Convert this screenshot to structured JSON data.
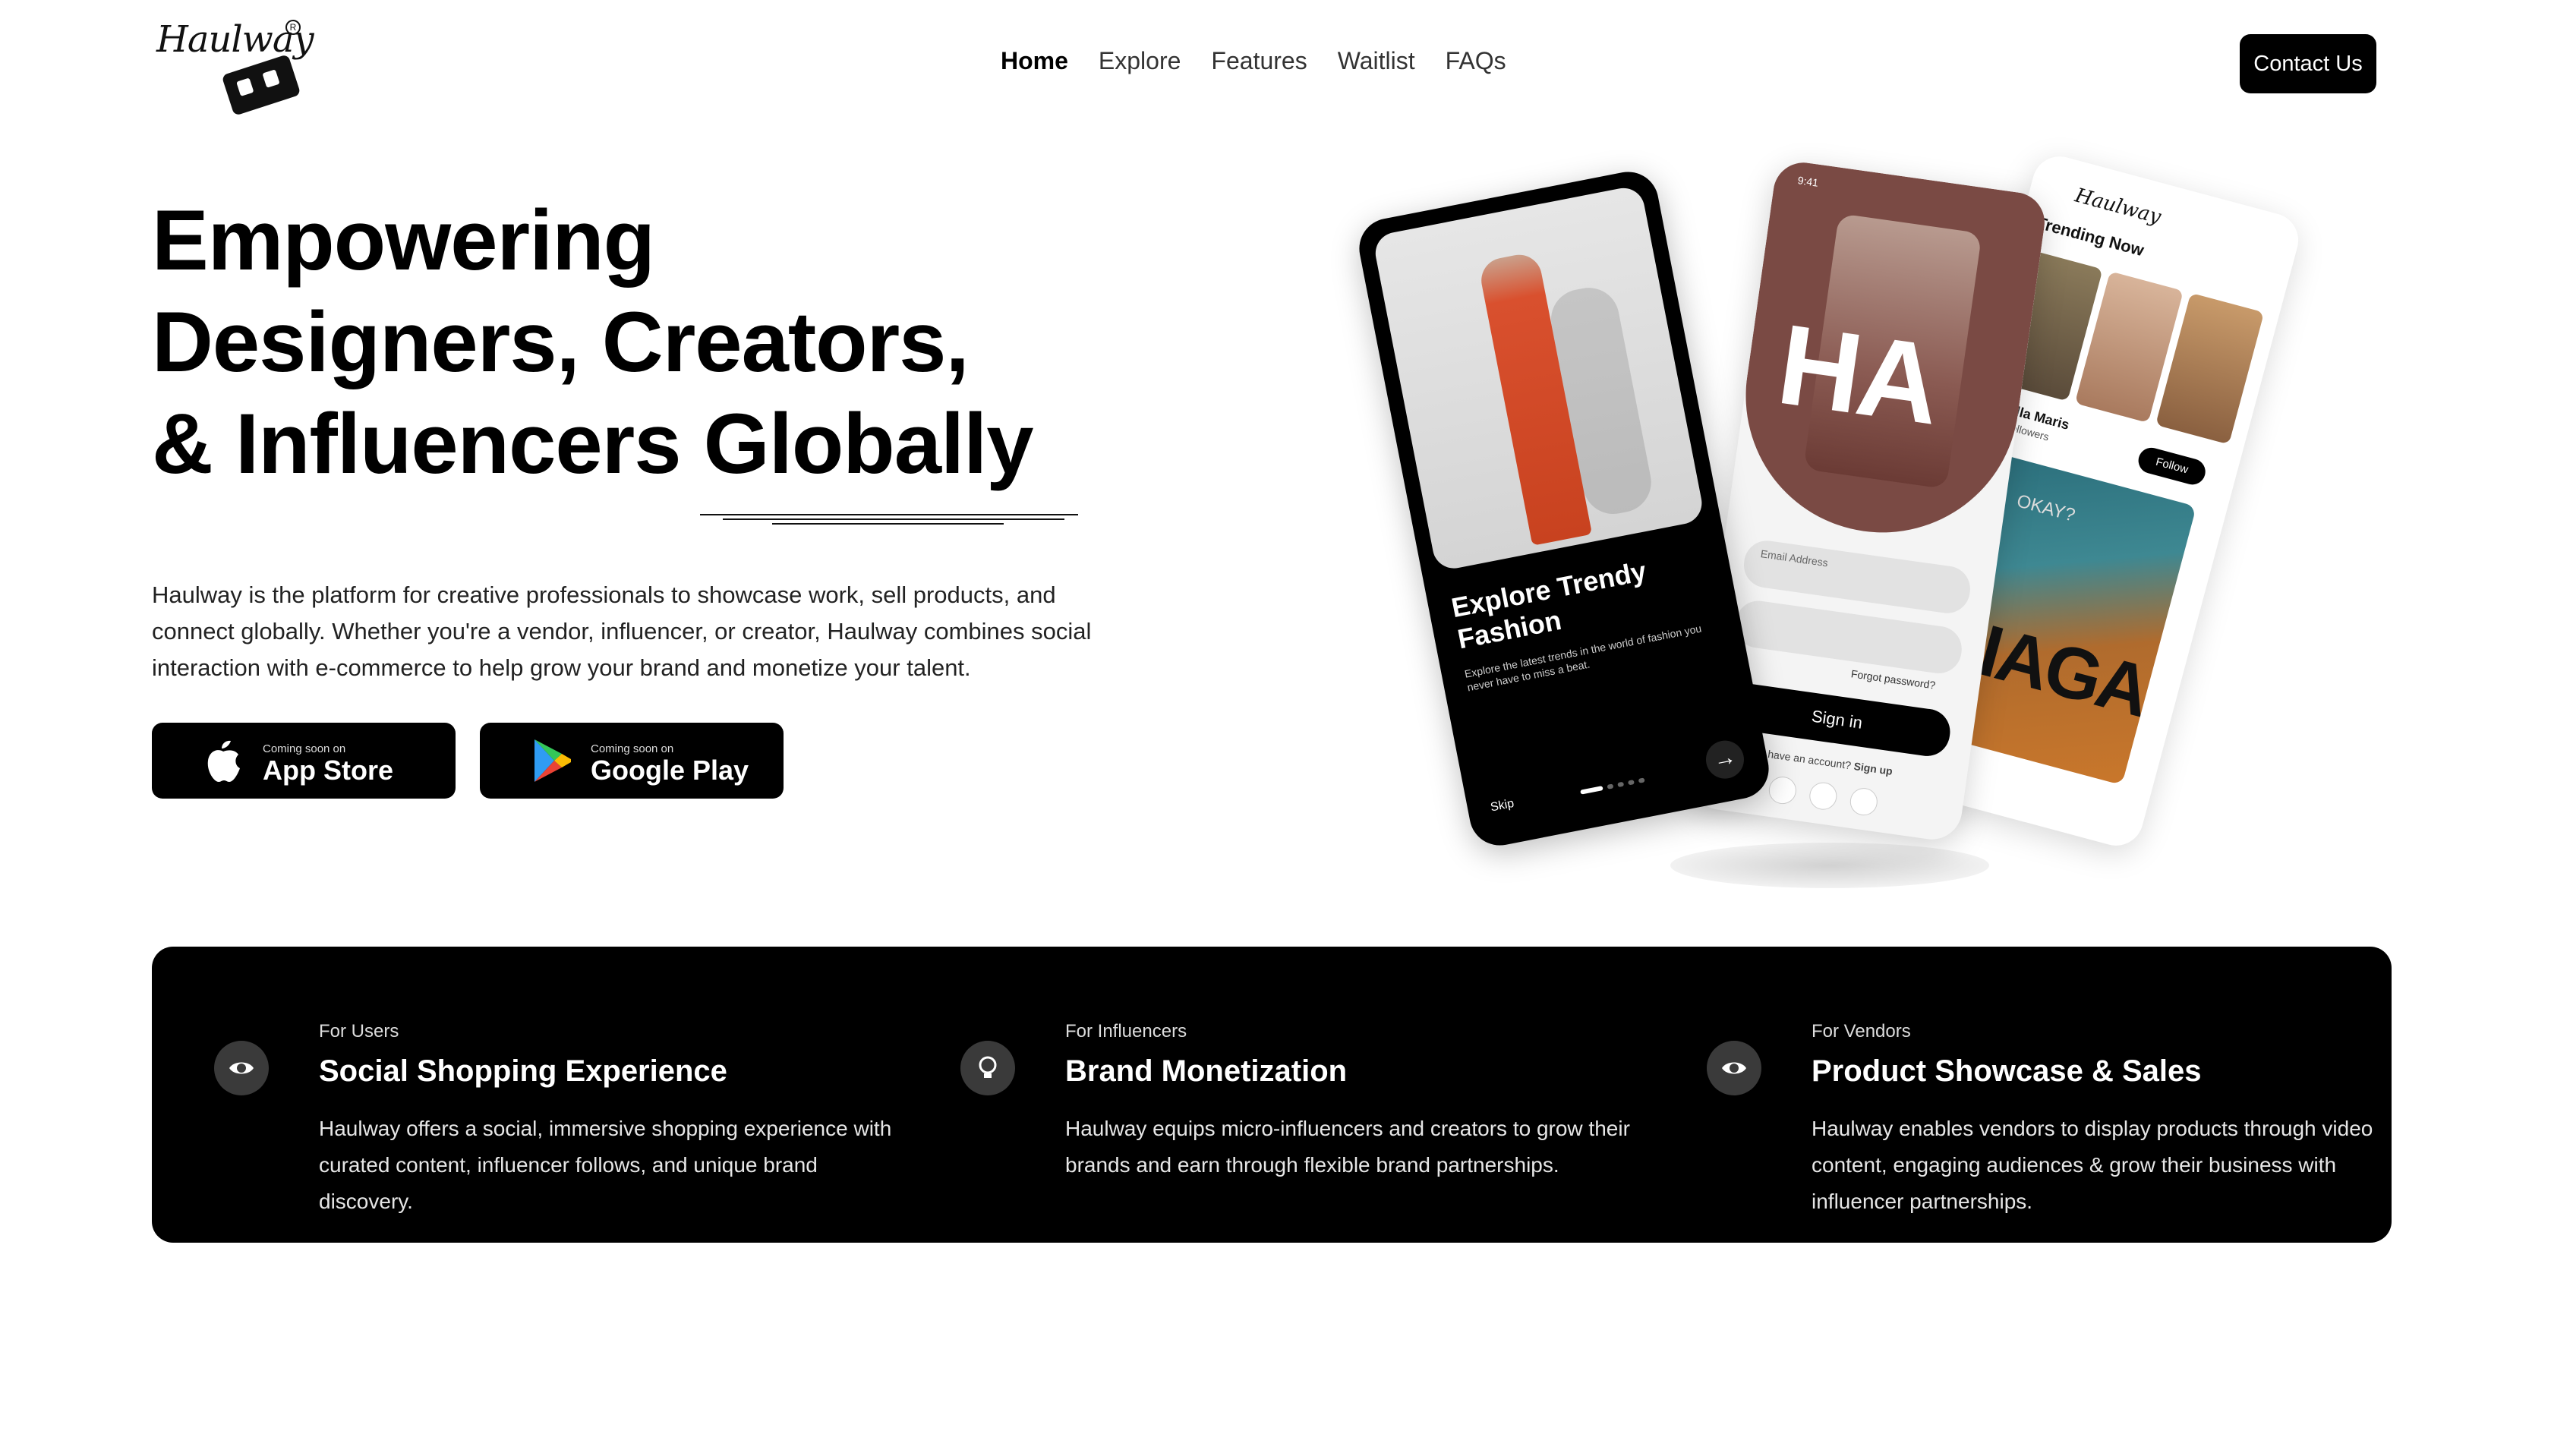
{
  "brand": {
    "logo_text": "Haulway"
  },
  "nav": {
    "items": [
      {
        "label": "Home",
        "active": true
      },
      {
        "label": "Explore",
        "active": false
      },
      {
        "label": "Features",
        "active": false
      },
      {
        "label": "Waitlist",
        "active": false
      },
      {
        "label": "FAQs",
        "active": false
      }
    ],
    "contact_label": "Contact Us"
  },
  "hero": {
    "title_lines": [
      "Empowering",
      "Designers, Creators,",
      "& Influencers Globally"
    ],
    "description": "Haulway is the platform for creative professionals to showcase work, sell products, and connect globally. Whether you're a vendor, influencer, or creator, Haulway combines social interaction with e-commerce to help grow your brand and monetize your talent.",
    "buttons": [
      {
        "small": "Coming soon on",
        "big": "App Store",
        "icon": "apple-icon"
      },
      {
        "small": "Coming soon on",
        "big": "Google Play",
        "icon": "google-play-icon"
      }
    ]
  },
  "phones": {
    "onboarding": {
      "title": "Explore Trendy Fashion",
      "subtitle": "Explore the latest trends in the world of fashion you never have to miss a beat.",
      "skip": "Skip"
    },
    "login": {
      "time": "9:41",
      "overlay": "HA",
      "email_label": "Email Address",
      "forgot": "Forgot password?",
      "signin": "Sign in",
      "account_prompt": "Don't have an account?",
      "signup": "Sign up"
    },
    "feed": {
      "logo": "Haulway",
      "trending": "Trending Now",
      "user": "Stella Maris",
      "followers": "5k Followers",
      "follow": "Follow",
      "photo_text": "CIAGA",
      "cap_text": "OKAY?"
    }
  },
  "features": [
    {
      "tag": "For Users",
      "title": "Social Shopping Experience",
      "description": "Haulway offers a social, immersive shopping experience with curated content, influencer follows, and unique brand discovery.",
      "icon": "eye-icon"
    },
    {
      "tag": "For Influencers",
      "title": "Brand Monetization",
      "description": "Haulway equips micro-influencers and creators to grow their brands and earn through flexible brand partnerships.",
      "icon": "lightbulb-icon"
    },
    {
      "tag": "For Vendors",
      "title": "Product Showcase & Sales",
      "description": "Haulway enables vendors to display products through video content, engaging audiences & grow their business with influencer partnerships.",
      "icon": "eye-icon"
    }
  ],
  "colors": {
    "primary": "#000000",
    "background": "#ffffff",
    "accent_brown": "#7a4a44"
  }
}
